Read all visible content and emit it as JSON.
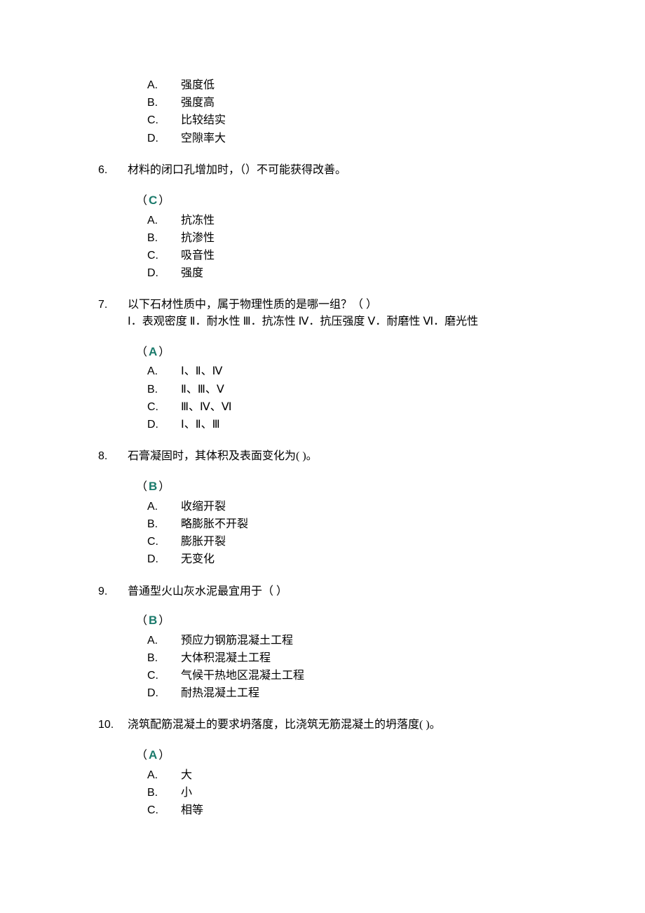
{
  "questions": [
    {
      "number": "",
      "text": "",
      "subtext": "",
      "answer": "",
      "options": [
        {
          "label": "A.",
          "text": "强度低"
        },
        {
          "label": "B.",
          "text": "强度高"
        },
        {
          "label": "C.",
          "text": "比较结实"
        },
        {
          "label": "D.",
          "text": "空隙率大"
        }
      ]
    },
    {
      "number": "6.",
      "text": "材料的闭口孔增加时，（）不可能获得改善。",
      "subtext": "",
      "answer": "C",
      "options": [
        {
          "label": "A.",
          "text": "抗冻性"
        },
        {
          "label": "B.",
          "text": " 抗渗性"
        },
        {
          "label": "C.",
          "text": "吸音性"
        },
        {
          "label": "D.",
          "text": "强度"
        }
      ]
    },
    {
      "number": "7.",
      "text": " 以下石材性质中，属于物理性质的是哪一组？（  ）",
      "subtext": "Ⅰ．表观密度  Ⅱ．耐水性  Ⅲ．抗冻性  Ⅳ．抗压强度  Ⅴ．耐磨性  Ⅵ．磨光性",
      "answer": "A",
      "options": [
        {
          "label": "A.",
          "text": " Ⅰ、Ⅱ、Ⅳ"
        },
        {
          "label": "B.",
          "text": " Ⅱ、Ⅲ、Ⅴ"
        },
        {
          "label": "C.",
          "text": " Ⅲ、Ⅳ、Ⅵ"
        },
        {
          "label": "D.",
          "text": " Ⅰ、Ⅱ、Ⅲ"
        }
      ]
    },
    {
      "number": "8.",
      "text": " 石膏凝固时，其体积及表面变化为(  )。",
      "subtext": "",
      "answer": "B",
      "options": [
        {
          "label": "A.",
          "text": " 收缩开裂"
        },
        {
          "label": "B.",
          "text": " 略膨胀不开裂"
        },
        {
          "label": "C.",
          "text": " 膨胀开裂"
        },
        {
          "label": "D.",
          "text": " 无变化"
        }
      ]
    },
    {
      "number": "9.",
      "text": " 普通型火山灰水泥最宜用于（ ）",
      "subtext": "",
      "answer": "B",
      "options": [
        {
          "label": "A.",
          "text": " 预应力钢筋混凝土工程"
        },
        {
          "label": "B.",
          "text": " 大体积混凝土工程"
        },
        {
          "label": "C.",
          "text": " 气候干热地区混凝土工程"
        },
        {
          "label": "D.",
          "text": " 耐热混凝土工程"
        }
      ]
    },
    {
      "number": "10.",
      "text": "浇筑配筋混凝土的要求坍落度，比浇筑无筋混凝土的坍落度(  )。",
      "subtext": "",
      "answer": "A",
      "options": [
        {
          "label": "A.",
          "text": " 大"
        },
        {
          "label": "B.",
          "text": " 小"
        },
        {
          "label": "C.",
          "text": " 相等"
        }
      ]
    }
  ],
  "paren_open": "（",
  "paren_close": "）"
}
